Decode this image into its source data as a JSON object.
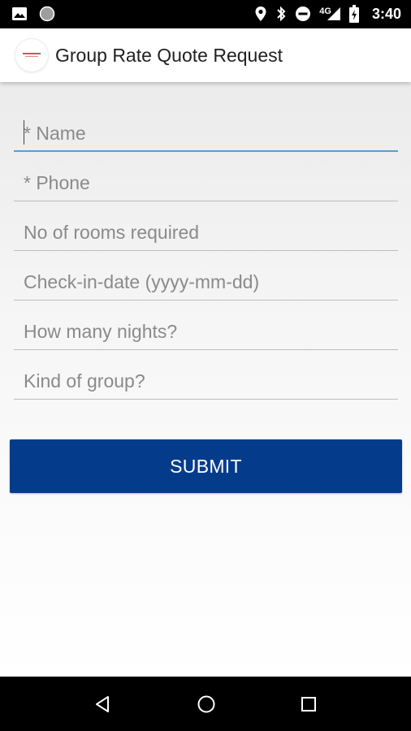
{
  "status_bar": {
    "time": "3:40",
    "network": "4G",
    "icons": [
      "image-icon",
      "circle-notification-icon",
      "location-icon",
      "bluetooth-icon",
      "do-not-disturb-icon",
      "signal-icon",
      "battery-icon"
    ]
  },
  "app_bar": {
    "title": "Group Rate Quote Request",
    "logo": "hotel-logo"
  },
  "form": {
    "fields": [
      {
        "placeholder": "* Name",
        "value": ""
      },
      {
        "placeholder": "* Phone",
        "value": ""
      },
      {
        "placeholder": "No of rooms required",
        "value": ""
      },
      {
        "placeholder": "Check-in-date (yyyy-mm-dd)",
        "value": ""
      },
      {
        "placeholder": "How many nights?",
        "value": ""
      },
      {
        "placeholder": "Kind of group?",
        "value": ""
      }
    ],
    "submit_label": "SUBMIT"
  },
  "colors": {
    "submit_button": "#043c8b",
    "focus_underline": "#5b9bd5"
  },
  "nav_bar": {
    "icons": [
      "back-icon",
      "home-icon",
      "recents-icon"
    ]
  }
}
